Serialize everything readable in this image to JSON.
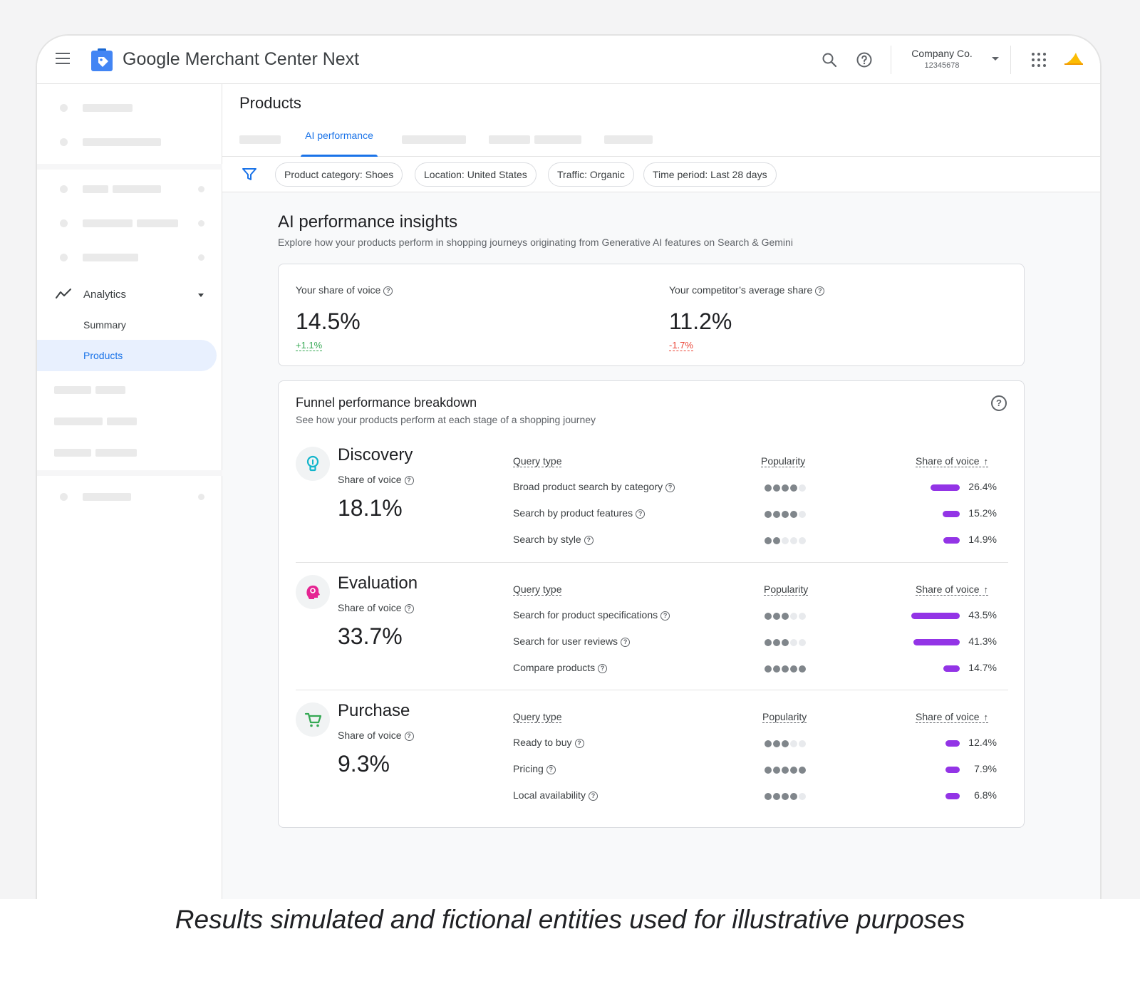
{
  "app": {
    "title_google": "Google",
    "title_rest": "Merchant Center Next",
    "account_name": "Company Co.",
    "account_id": "12345678"
  },
  "sidebar": {
    "analytics_label": "Analytics",
    "summary_label": "Summary",
    "products_label": "Products"
  },
  "page": {
    "title": "Products",
    "active_tab": "AI performance"
  },
  "filters": [
    "Product category: Shoes",
    "Location: United States",
    "Traffic: Organic",
    "Time period: Last 28 days"
  ],
  "insights": {
    "title": "AI performance insights",
    "subtitle": "Explore how your products perform in shopping journeys originating from Generative AI features on Search & Gemini"
  },
  "share_of_voice": {
    "yours_label": "Your share of voice",
    "yours_value": "14.5%",
    "yours_delta": "+1.1%",
    "competitor_label": "Your competitor’s average share",
    "competitor_value": "11.2%",
    "competitor_delta": "-1.7%",
    "positive_color": "#34a853",
    "negative_color": "#ea4335"
  },
  "funnel": {
    "title": "Funnel performance breakdown",
    "subtitle": "See how your products perform at each stage of a shopping journey",
    "col_query": "Query type",
    "col_popularity": "Popularity",
    "col_sov": "Share of voice",
    "sov_label": "Share of voice",
    "bar_color": "#9334e6",
    "stages": [
      {
        "name": "Discovery",
        "icon": "lightbulb-icon",
        "sov": "18.1%",
        "rows": [
          {
            "label": "Broad product search by category",
            "popularity": 4,
            "sov": 26.4,
            "sov_text": "26.4%"
          },
          {
            "label": "Search by product features",
            "popularity": 4,
            "sov": 15.2,
            "sov_text": "15.2%"
          },
          {
            "label": "Search by style",
            "popularity": 2,
            "sov": 14.9,
            "sov_text": "14.9%"
          }
        ]
      },
      {
        "name": "Evaluation",
        "icon": "head-thinking-icon",
        "sov": "33.7%",
        "rows": [
          {
            "label": "Search for product specifications",
            "popularity": 3,
            "sov": 43.5,
            "sov_text": "43.5%"
          },
          {
            "label": "Search for user reviews",
            "popularity": 3,
            "sov": 41.3,
            "sov_text": "41.3%"
          },
          {
            "label": "Compare products",
            "popularity": 5,
            "sov": 14.7,
            "sov_text": "14.7%"
          }
        ]
      },
      {
        "name": "Purchase",
        "icon": "shopping-cart-icon",
        "sov": "9.3%",
        "rows": [
          {
            "label": "Ready to buy",
            "popularity": 3,
            "sov": 12.4,
            "sov_text": "12.4%"
          },
          {
            "label": "Pricing",
            "popularity": 5,
            "sov": 7.9,
            "sov_text": "7.9%"
          },
          {
            "label": "Local availability",
            "popularity": 4,
            "sov": 6.8,
            "sov_text": "6.8%"
          }
        ]
      }
    ]
  },
  "caption": "Results simulated and fictional entities used for illustrative purposes"
}
